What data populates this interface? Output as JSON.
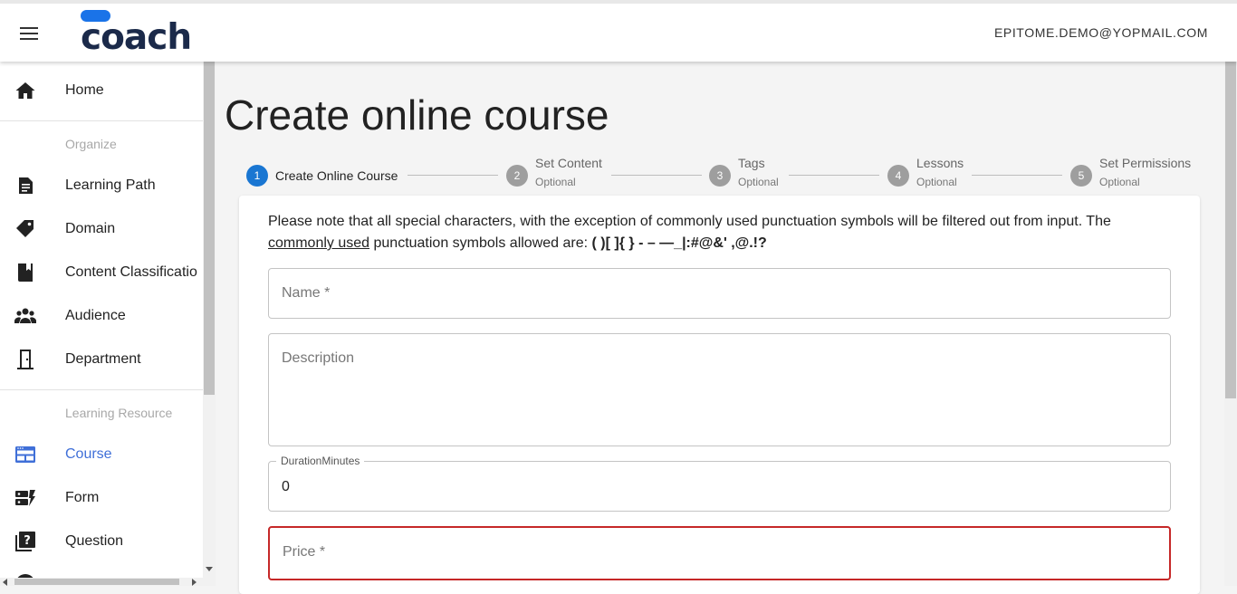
{
  "header": {
    "logo_text": "coach",
    "user_email": "EPITOME.DEMO@YOPMAIL.COM",
    "brand_color": "#1a73e8"
  },
  "sidebar": {
    "home": {
      "label": "Home",
      "icon": "home-icon"
    },
    "section_organize": "Organize",
    "organize_items": [
      {
        "label": "Learning Path",
        "icon": "document-icon"
      },
      {
        "label": "Domain",
        "icon": "tag-icon"
      },
      {
        "label": "Content Classificatio",
        "icon": "book-icon"
      },
      {
        "label": "Audience",
        "icon": "people-icon"
      },
      {
        "label": "Department",
        "icon": "door-icon"
      }
    ],
    "section_learning_resource": "Learning Resource",
    "resource_items": [
      {
        "label": "Course",
        "icon": "course-icon",
        "active": true
      },
      {
        "label": "Form",
        "icon": "form-icon"
      },
      {
        "label": "Question",
        "icon": "question-icon"
      }
    ],
    "active_color": "#3f6fd8"
  },
  "main": {
    "title": "Create online course",
    "steps": [
      {
        "number": "1",
        "label": "Create Online Course",
        "optional": "",
        "active": true
      },
      {
        "number": "2",
        "label": "Set Content",
        "optional": "Optional"
      },
      {
        "number": "3",
        "label": "Tags",
        "optional": "Optional"
      },
      {
        "number": "4",
        "label": "Lessons",
        "optional": "Optional"
      },
      {
        "number": "5",
        "label": "Set Permissions",
        "optional": "Optional"
      }
    ],
    "notice": {
      "part1": "Please note that all special characters, with the exception of commonly used punctuation symbols will be filtered out from input. The",
      "link": "commonly used",
      "part2": " punctuation symbols allowed are: ",
      "symbols": "( )[ ]{ } - – —_|:#@&' ,@.!?"
    },
    "form": {
      "name_placeholder": "Name *",
      "description_placeholder": "Description",
      "duration_label": "DurationMinutes",
      "duration_value": "0",
      "price_placeholder": "Price *"
    },
    "error_color": "#c62828",
    "step_active_color": "#1976d2"
  }
}
